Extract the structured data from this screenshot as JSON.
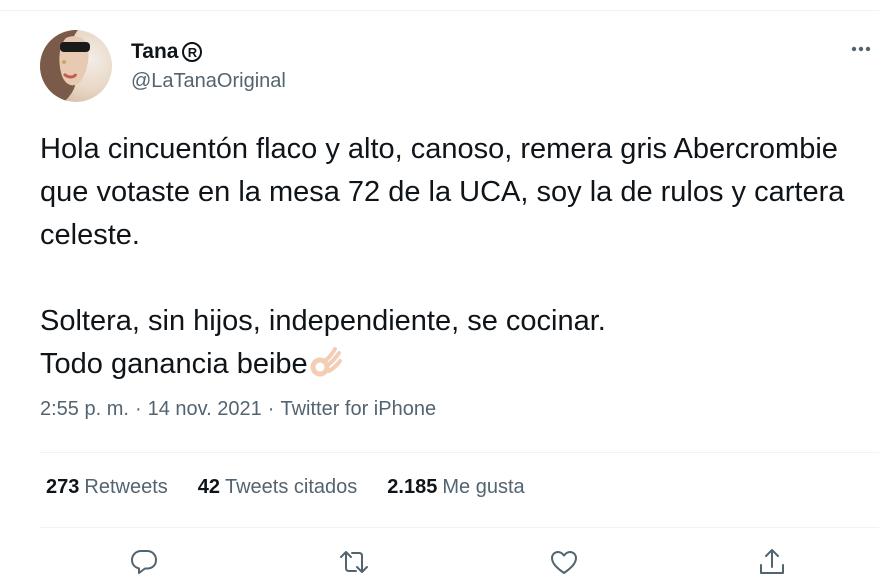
{
  "author": {
    "display_name": "Tana",
    "registered_mark": "R",
    "handle": "@LaTanaOriginal",
    "avatar": "profile-photo"
  },
  "tweet": {
    "paragraph_1": "Hola cincuentón flaco y alto, canoso, remera gris Abercrombie que votaste en la mesa 72 de la UCA, soy la de rulos y cartera celeste.",
    "paragraph_2_line_1": "Soltera, sin hijos, independiente, se cocinar.",
    "paragraph_2_line_2": "Todo ganancia beibe",
    "emoji": "ok-hand"
  },
  "meta": {
    "time": "2:55 p. m.",
    "sep1": "·",
    "date": "14 nov. 2021",
    "sep2": "·",
    "source": "Twitter for iPhone"
  },
  "stats": {
    "retweets_count": "273",
    "retweets_label": "Retweets",
    "quotes_count": "42",
    "quotes_label": "Tweets citados",
    "likes_count": "2.185",
    "likes_label": "Me gusta"
  },
  "actions": [
    "reply-icon",
    "retweet-icon",
    "like-icon",
    "share-icon"
  ],
  "colors": {
    "text": "#0f1419",
    "secondary": "#536471",
    "divider": "#eff3f4",
    "emoji_skin": "#f6d9c4"
  }
}
